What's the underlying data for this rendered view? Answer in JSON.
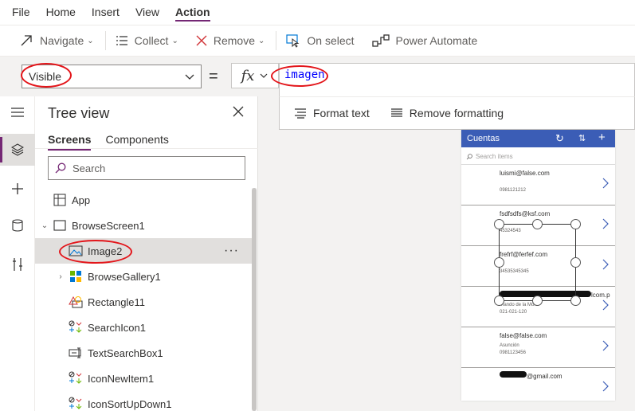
{
  "menu": [
    {
      "label": "File",
      "active": false
    },
    {
      "label": "Home",
      "active": false
    },
    {
      "label": "Insert",
      "active": false
    },
    {
      "label": "View",
      "active": false
    },
    {
      "label": "Action",
      "active": true
    }
  ],
  "toolbar": {
    "navigate": "Navigate",
    "collect": "Collect",
    "remove": "Remove",
    "on_select": "On select",
    "power_automate": "Power Automate"
  },
  "formula": {
    "property": "Visible",
    "equals": "=",
    "fx": "fx",
    "expression": "imagen"
  },
  "format": {
    "format_text": "Format text",
    "remove_formatting": "Remove formatting"
  },
  "tree": {
    "title": "Tree view",
    "tabs": [
      "Screens",
      "Components"
    ],
    "search_placeholder": "Search",
    "nodes": [
      {
        "label": "App",
        "icon": "app-icon"
      },
      {
        "label": "BrowseScreen1",
        "icon": "screen-icon"
      },
      {
        "label": "Image2",
        "icon": "image-icon",
        "selected": true
      },
      {
        "label": "BrowseGallery1",
        "icon": "gallery-icon"
      },
      {
        "label": "Rectangle11",
        "icon": "rectangle-icon"
      },
      {
        "label": "SearchIcon1",
        "icon": "icon-control-icon"
      },
      {
        "label": "TextSearchBox1",
        "icon": "textbox-icon"
      },
      {
        "label": "IconNewItem1",
        "icon": "icon-control-icon"
      },
      {
        "label": "IconSortUpDown1",
        "icon": "icon-control-icon"
      }
    ],
    "more": "···"
  },
  "preview": {
    "header_title": "Cuentas",
    "search_placeholder": "Search items",
    "items": [
      {
        "title": "luismi@false.com",
        "line1": "0981121212",
        "line2": ""
      },
      {
        "title": "fsdfsdfs@ksf.com",
        "line1": "45324543",
        "line2": ""
      },
      {
        "title": "frefrf@ferfef.com",
        "line1": "34535345345",
        "line2": ""
      },
      {
        "title": "lcom.p",
        "line1": "rnando de la Mora",
        "line2": "021-021-120"
      },
      {
        "title": "false@false.com",
        "line1": "Asunción",
        "line2": "0981123456"
      },
      {
        "title": "@gmail.com",
        "line1": "",
        "line2": ""
      }
    ]
  },
  "colors": {
    "accent": "#742774",
    "header_blue": "#3b5db6",
    "annotation_red": "#e3151a",
    "formula_blue": "#0000ff"
  }
}
